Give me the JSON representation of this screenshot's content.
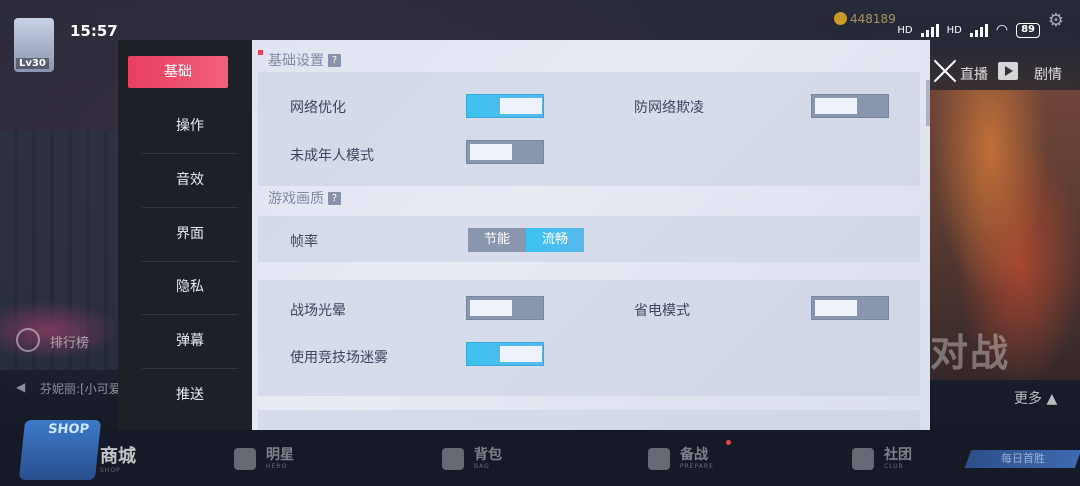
{
  "status_bar": {
    "time": "15:57",
    "net1": "HD",
    "net2": "HD",
    "battery": "89"
  },
  "hud": {
    "level": "Lv30",
    "coins": "448189",
    "live": "直播",
    "drama": "剧情"
  },
  "side_info": {
    "rank": "排行榜",
    "chat": "芬妮丽:[小可爱",
    "more": "更多 ▲",
    "big_text": "对战"
  },
  "bottom_nav": {
    "shop": {
      "badge": "SHOP",
      "label": "商城",
      "sub": "SHOP"
    },
    "items": [
      {
        "label": "明星",
        "sub": "HERO"
      },
      {
        "label": "背包",
        "sub": "BAG"
      },
      {
        "label": "备战",
        "sub": "PREPARE"
      },
      {
        "label": "社团",
        "sub": "CLUB"
      }
    ],
    "daily": "每日首胜"
  },
  "settings": {
    "tabs": [
      "基础",
      "操作",
      "音效",
      "界面",
      "隐私",
      "弹幕",
      "推送"
    ],
    "active_tab": "基础",
    "sections": {
      "basic": {
        "title": "基础设置",
        "help": "?"
      },
      "quality": {
        "title": "游戏画质",
        "help": "?"
      }
    },
    "rows": {
      "network_opt": {
        "label": "网络优化",
        "state": "on"
      },
      "anti_bully": {
        "label": "防网络欺凌",
        "state": "off"
      },
      "minor_mode": {
        "label": "未成年人模式",
        "state": "off"
      },
      "frame_rate": {
        "label": "帧率",
        "options": [
          "节能",
          "流畅"
        ],
        "selected": "流畅"
      },
      "halo": {
        "label": "战场光晕",
        "state": "off"
      },
      "power_save": {
        "label": "省电模式",
        "state": "off"
      },
      "fog": {
        "label": "使用竞技场迷雾",
        "state": "on"
      }
    }
  },
  "colors": {
    "accent": "#e8405e",
    "toggle_on": "#3cc2f0",
    "toggle_off": "#8a96ad"
  }
}
